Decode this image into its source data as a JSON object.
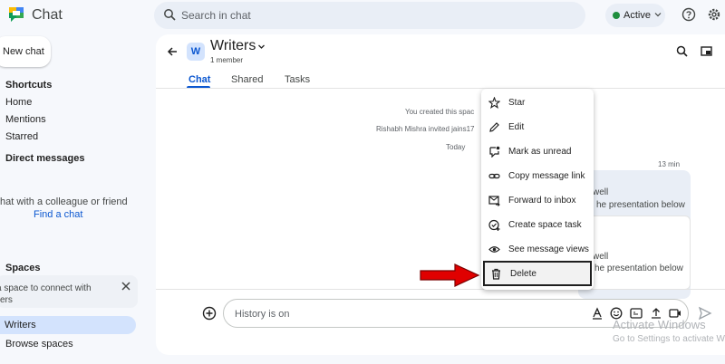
{
  "app": {
    "title": "Chat",
    "logo_icon": "google-chat-logo"
  },
  "search": {
    "placeholder": "Search in chat"
  },
  "status": {
    "label": "Active",
    "color": "#1e8e3e"
  },
  "top_icons": [
    "help-icon",
    "settings-icon"
  ],
  "sidebar": {
    "new_chat": "New chat",
    "shortcuts_heading": "Shortcuts",
    "shortcuts": [
      "Home",
      "Mentions",
      "Starred"
    ],
    "dm_heading": "Direct messages",
    "dm_empty_text": "hat with a colleague or friend",
    "dm_find_link": "Find a chat",
    "spaces_heading": "Spaces",
    "spaces_card_line1": "a space to connect with",
    "spaces_card_line2": "ers",
    "spaces": [
      "Writers",
      "Browse spaces"
    ],
    "active_space": "Writers"
  },
  "space": {
    "avatar_letter": "W",
    "name": "Writers",
    "members": "1 member",
    "tabs": [
      "Chat",
      "Shared",
      "Tasks"
    ],
    "active_tab": "Chat"
  },
  "messages": {
    "system_1": "You created this spac",
    "system_2": "Rishabh Mishra invited jains17",
    "day": "Today",
    "time": "13 min",
    "bubble_lines": [
      "well",
      "he presentation below",
      "well",
      "he presentation below"
    ]
  },
  "composer": {
    "placeholder": "History is on"
  },
  "context_menu": {
    "items": [
      {
        "label": "Star",
        "icon": "star-icon"
      },
      {
        "label": "Edit",
        "icon": "pencil-icon"
      },
      {
        "label": "Mark as unread",
        "icon": "mark-unread-icon"
      },
      {
        "label": "Copy message link",
        "icon": "link-icon"
      },
      {
        "label": "Forward to inbox",
        "icon": "forward-mail-icon"
      },
      {
        "label": "Create space task",
        "icon": "task-add-icon"
      },
      {
        "label": "See message views",
        "icon": "eye-icon"
      },
      {
        "label": "Delete",
        "icon": "trash-icon"
      }
    ],
    "highlighted_item": "Delete",
    "annotation_arrow_color": "#e00000"
  },
  "watermark": {
    "title": "Activate Windows",
    "subtitle": "Go to Settings to activate Wi"
  },
  "colors": {
    "accent": "#0b57d0",
    "background": "#f6f8fc",
    "active_nav": "#d3e3fd"
  }
}
